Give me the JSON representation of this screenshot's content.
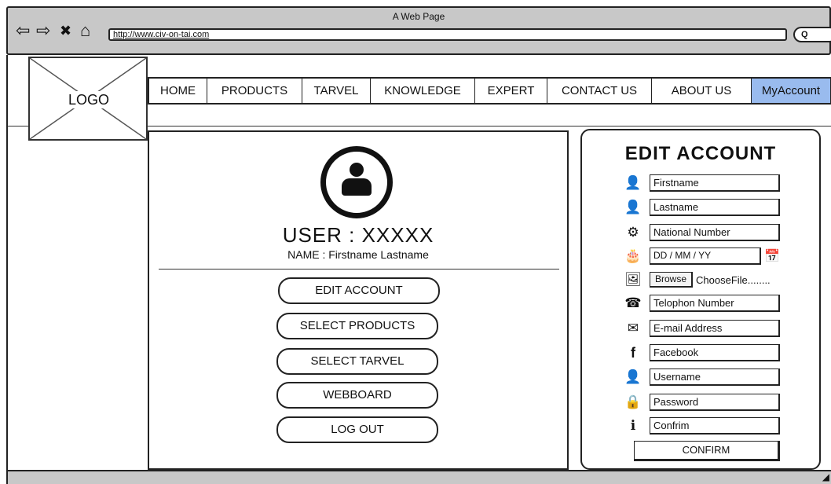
{
  "browser": {
    "window_title": "A Web Page",
    "url": "http://www.civ-on-tai.com",
    "back_glyph": "⇦",
    "forward_glyph": "⇨",
    "close_glyph": "✖",
    "home_glyph": "⌂",
    "search_glyph": "Q"
  },
  "header": {
    "logo_text": "LOGO",
    "nav": [
      {
        "label": "HOME"
      },
      {
        "label": "PRODUCTS"
      },
      {
        "label": "TARVEL"
      },
      {
        "label": "KNOWLEDGE"
      },
      {
        "label": "EXPERT"
      },
      {
        "label": "CONTACT US"
      },
      {
        "label": "ABOUT US"
      },
      {
        "label": "MyAccount",
        "active": true
      }
    ],
    "active_color": "#99bbee"
  },
  "profile": {
    "user_title": "USER : XXXXX",
    "name_line": "NAME : Firstname Lastname",
    "menu": [
      {
        "label": "EDIT ACCOUNT"
      },
      {
        "label": "SELECT PRODUCTS"
      },
      {
        "label": "SELECT TARVEL"
      },
      {
        "label": "WEBBOARD"
      },
      {
        "label": "LOG OUT"
      }
    ]
  },
  "edit_account": {
    "title": "EDIT ACCOUNT",
    "fields": [
      {
        "icon": "add-user-icon",
        "glyph": "👤",
        "placeholder": "Firstname"
      },
      {
        "icon": "add-user-icon",
        "glyph": "👤",
        "placeholder": "Lastname"
      },
      {
        "icon": "gear-icon",
        "glyph": "⚙",
        "placeholder": "National Number"
      },
      {
        "icon": "birthday-cake-icon",
        "glyph": "🎂",
        "placeholder": "DD / MM / YY"
      },
      {
        "icon": "image-file-icon",
        "glyph": "🖼",
        "browse_label": "Browse",
        "file_label": "ChooseFile........"
      },
      {
        "icon": "phone-icon",
        "glyph": "☎",
        "placeholder": "Telophon Number"
      },
      {
        "icon": "envelope-icon",
        "glyph": "✉",
        "placeholder": "E-mail Address"
      },
      {
        "icon": "facebook-icon",
        "glyph": "f",
        "placeholder": "Facebook"
      },
      {
        "icon": "user-icon",
        "glyph": "👤",
        "placeholder": "Username"
      },
      {
        "icon": "lock-icon",
        "glyph": "🔒",
        "placeholder": "Password"
      },
      {
        "icon": "info-icon",
        "glyph": "ℹ",
        "placeholder": "Confrim"
      }
    ],
    "calendar_glyph": "📅",
    "confirm_label": "CONFIRM"
  }
}
